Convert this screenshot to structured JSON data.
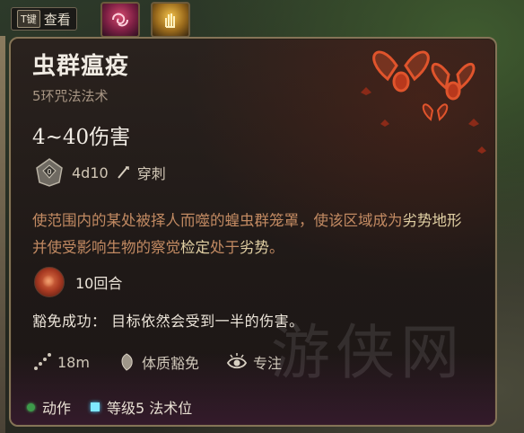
{
  "hotbar": {
    "key_cap": "T键",
    "view_label": "查看"
  },
  "spell": {
    "name": "虫群瘟疫",
    "level_school": "5环咒法法术",
    "damage": "4~40伤害",
    "dice": "4d10",
    "dice_face": "0",
    "damage_type": "穿刺",
    "description": {
      "part1": "使范围内的某处被择人而噬的蝗虫群笼罩，使该区域成为",
      "term1": "劣势地形",
      "part2": "并使受影响生物的察觉",
      "term2": "检定",
      "part3": "处于",
      "term3": "劣势",
      "part4": "。"
    },
    "duration": "10回合",
    "save_success": "豁免成功：  目标依然会受到一半的伤害。",
    "range": "18m",
    "save_type": "体质豁免",
    "concentration": "专注"
  },
  "cost": {
    "action": "动作",
    "spell_slot": "等级5 法术位"
  },
  "watermark_text": "游侠网",
  "colors": {
    "description": "#c28a62",
    "highlight": "#e0cfa3",
    "action_dot": "#3d9a4a",
    "spell_slot_square": "#7fe8ff",
    "border": "#857457"
  },
  "icons": {
    "dice": "d10-dice-icon",
    "damage_type": "piercing-icon",
    "duration": "duration-swarm-icon",
    "range": "range-icon",
    "save": "shield-icon",
    "concentration": "concentration-eye-icon"
  }
}
